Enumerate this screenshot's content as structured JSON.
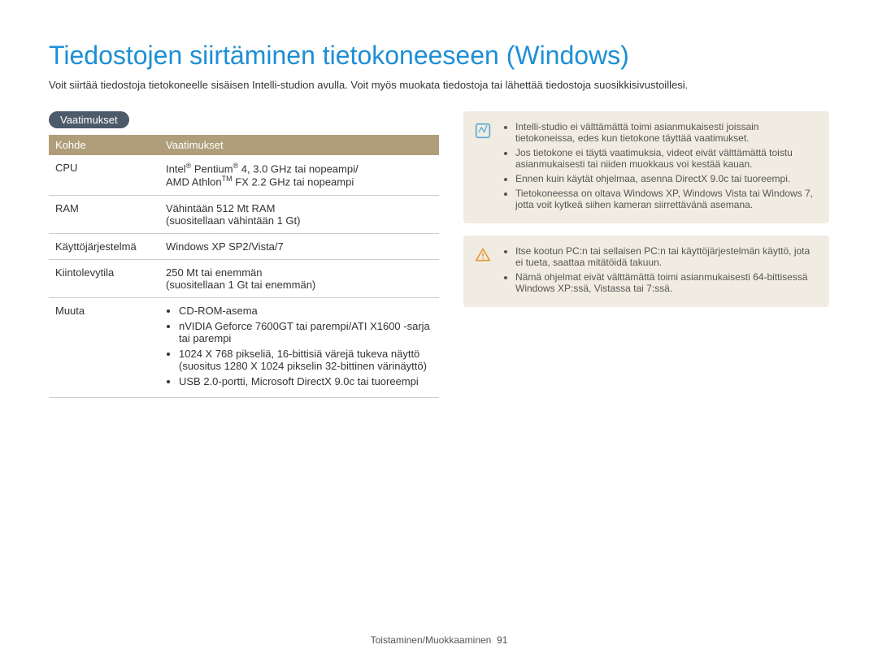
{
  "title": "Tiedostojen siirtäminen tietokoneeseen (Windows)",
  "intro": "Voit siirtää tiedostoja tietokoneelle sisäisen Intelli-studion avulla. Voit myös muokata tiedostoja tai lähettää tiedostoja suosikkisivustoillesi.",
  "section_label": "Vaatimukset",
  "table": {
    "header_key": "Kohde",
    "header_val": "Vaatimukset",
    "rows": {
      "cpu": {
        "key": "CPU",
        "line1_prefix": "Intel",
        "line1_mid": " Pentium",
        "line1_suffix": " 4, 3.0 GHz tai nopeampi/",
        "line2_prefix": "AMD Athlon",
        "line2_tm": "TM",
        "line2_suffix": " FX 2.2 GHz tai nopeampi"
      },
      "ram": {
        "key": "RAM",
        "line1": "Vähintään 512 Mt RAM",
        "line2": "(suositellaan vähintään 1 Gt)"
      },
      "os": {
        "key": "Käyttöjärjestelmä",
        "val": "Windows XP SP2/Vista/7"
      },
      "hdd": {
        "key": "Kiintolevytila",
        "line1": "250 Mt tai enemmän",
        "line2": "(suositellaan 1 Gt tai enemmän)"
      },
      "other": {
        "key": "Muuta",
        "b1": "CD-ROM-asema",
        "b2": "nVIDIA Geforce 7600GT tai parempi/ATI X1600 -sarja tai parempi",
        "b3": "1024 X 768 pikseliä, 16-bittisiä värejä tukeva näyttö (suositus 1280 X 1024 pikselin 32-bittinen värinäyttö)",
        "b4": "USB 2.0-portti, Microsoft DirectX 9.0c tai tuoreempi"
      }
    }
  },
  "info_box": {
    "b1": "Intelli-studio ei välttämättä toimi asianmukaisesti joissain tietokoneissa, edes kun tietokone täyttää vaatimukset.",
    "b2": "Jos tietokone ei täytä vaatimuksia, videot eivät välttämättä toistu asianmukaisesti tai niiden muokkaus voi kestää kauan.",
    "b3": "Ennen kuin käytät ohjelmaa, asenna DirectX 9.0c tai tuoreempi.",
    "b4": "Tietokoneessa on oltava Windows XP, Windows Vista tai Windows 7, jotta voit kytkeä siihen kameran siirrettävänä asemana."
  },
  "warn_box": {
    "b1": "Itse kootun PC:n tai sellaisen PC:n tai käyttöjärjestelmän käyttö, jota ei tueta, saattaa mitätöidä takuun.",
    "b2": "Nämä ohjelmat eivät välttämättä toimi asianmukaisesti 64-bittisessä Windows XP:ssä, Vistassa tai 7:ssä."
  },
  "footer": {
    "section": "Toistaminen/Muokkaaminen",
    "page": "91"
  }
}
